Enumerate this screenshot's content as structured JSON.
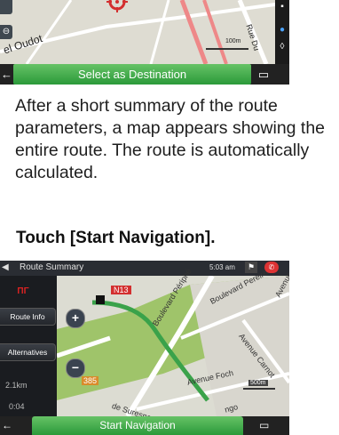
{
  "select_screen": {
    "street_left": "el Oudot",
    "street_right": "Rue Du",
    "scale": "100m",
    "button_label": "Select as Destination",
    "back_glyph": "←",
    "menu_glyph": "▭"
  },
  "paragraph": "After a short summary of the route parameters, a map appears showing the entire route. The route is automatically calculated.",
  "heading": "Touch [Start Navigation].",
  "route_summary": {
    "header": {
      "back_glyph": "◀",
      "title": "Route Summary",
      "time": "5:03 am",
      "flag_icon": "flag-icon",
      "phone_icon": "phone-icon"
    },
    "side": {
      "buttons": [
        "Route Info",
        "Alternatives"
      ],
      "distance": "2.1km",
      "duration": "0:04"
    },
    "map_labels": {
      "n13": "N13",
      "route_label": "385",
      "bd_periph": "Boulevard Périphé",
      "bd_pereire": "Boulevard Pereire",
      "av_niel": "Avenue Ni",
      "av_carnot": "Avenue Carnot",
      "av_foch": "Avenue Foch",
      "des_suresnes": "de Suresnes",
      "lego": "ngo",
      "scale": "500m"
    },
    "zoom_in": "+",
    "zoom_out": "−",
    "start_button": "Start Navigation",
    "menu_glyph": "▭"
  },
  "colors": {
    "accent_green": "#2b9a3a",
    "route_red": "#d32f2f"
  }
}
